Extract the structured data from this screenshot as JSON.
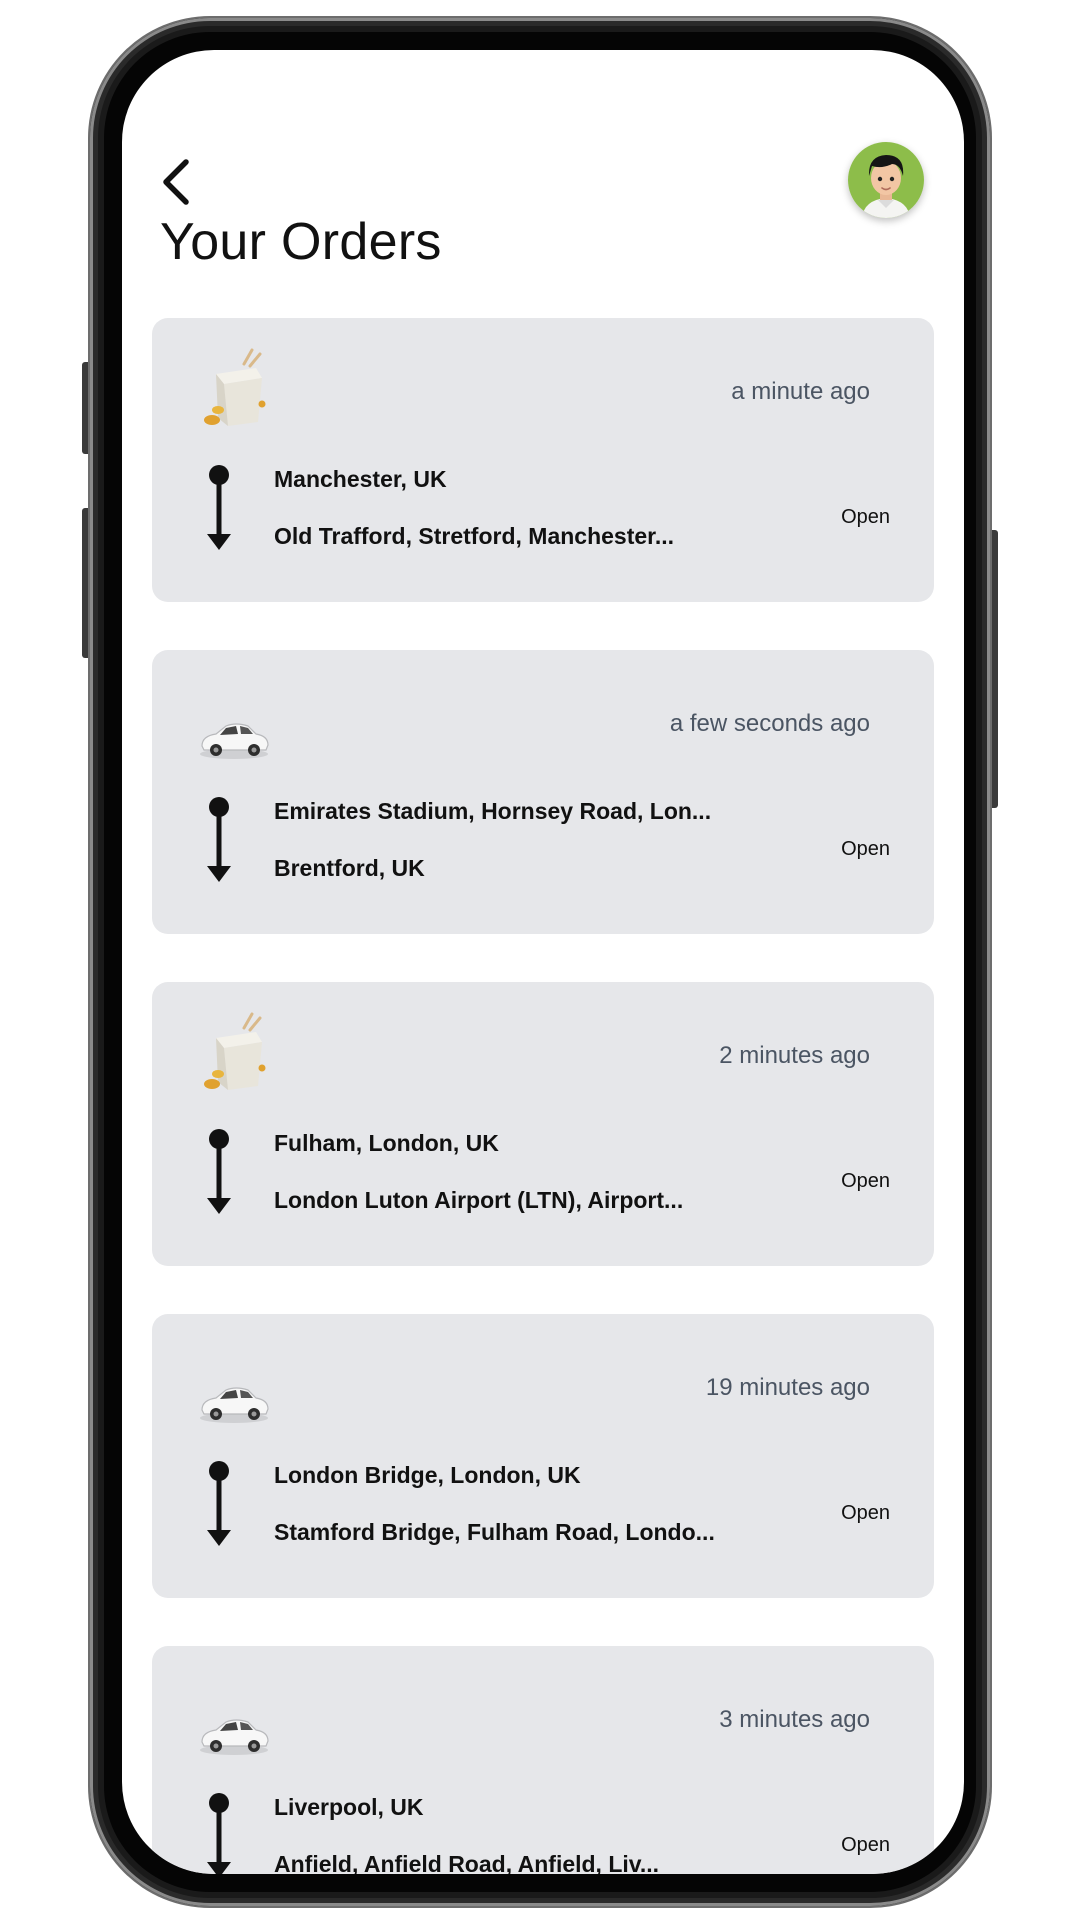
{
  "header": {
    "title": "Your Orders",
    "back_icon": "chevron-left-icon",
    "avatar_icon": "user-avatar"
  },
  "orders": [
    {
      "service": "food-box-icon",
      "time": "a minute ago",
      "from": "Manchester, UK",
      "to": "Old Trafford, Stretford, Manchester...",
      "action": "Open"
    },
    {
      "service": "car-icon",
      "time": "a few seconds ago",
      "from": "Emirates Stadium, Hornsey Road, Lon...",
      "to": "Brentford, UK",
      "action": "Open"
    },
    {
      "service": "food-box-icon",
      "time": "2 minutes ago",
      "from": "Fulham, London, UK",
      "to": "London Luton Airport (LTN), Airport...",
      "action": "Open"
    },
    {
      "service": "car-icon",
      "time": "19 minutes ago",
      "from": "London Bridge, London, UK",
      "to": "Stamford Bridge, Fulham Road, Londo...",
      "action": "Open"
    },
    {
      "service": "car-icon",
      "time": "3 minutes ago",
      "from": "Liverpool, UK",
      "to": "Anfield, Anfield Road, Anfield, Liv...",
      "action": "Open"
    }
  ],
  "colors": {
    "card_bg": "#e6e7ea",
    "time_text": "#4b5563",
    "avatar_bg": "#8dbd4a"
  }
}
